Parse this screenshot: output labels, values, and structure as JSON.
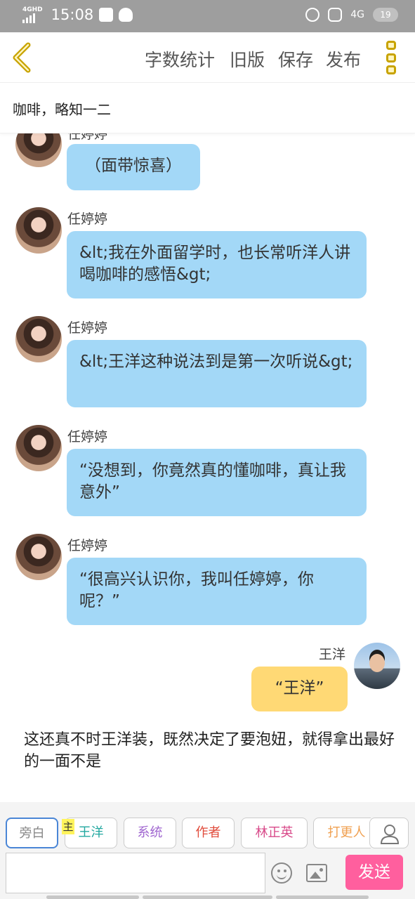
{
  "status_bar": {
    "network": "4GHD",
    "time": "15:08",
    "net2": "4G",
    "battery": "19"
  },
  "header": {
    "menu": [
      "字数统计",
      "旧版",
      "保存",
      "发布"
    ],
    "accent": "#c8a300"
  },
  "title": "咖啡，略知一二",
  "messages": [
    {
      "name": "任婷婷",
      "text": "（面带惊喜）",
      "side": "left"
    },
    {
      "name": "任婷婷",
      "text": "&lt;我在外面留学时，也长常听洋人讲喝咖啡的感悟&gt;",
      "side": "left"
    },
    {
      "name": "任婷婷",
      "text": "&lt;王洋这种说法到是第一次听说&gt;",
      "side": "left"
    },
    {
      "name": "任婷婷",
      "text": "“没想到，你竟然真的懂咖啡，真让我意外”",
      "side": "left"
    },
    {
      "name": "任婷婷",
      "text": "“很高兴认识你，我叫任婷婷，你呢？”",
      "side": "left"
    },
    {
      "name": "王洋",
      "text": "“王洋”",
      "side": "right"
    }
  ],
  "narration": "这还真不时王洋装，既然决定了要泡妞，就得拿出最好的一面不是",
  "roles": [
    {
      "label": "旁白",
      "color": "#888888"
    },
    {
      "label": "王洋",
      "color": "#22a8a0"
    },
    {
      "label": "系统",
      "color": "#a066d0"
    },
    {
      "label": "作者",
      "color": "#e04a3a"
    },
    {
      "label": "林正英",
      "color": "#d84a8a"
    },
    {
      "label": "打更人",
      "color": "#f0a050"
    }
  ],
  "role_tag": "主",
  "send_label": "发送",
  "colors": {
    "bubble_left": "#a3d8f7",
    "bubble_right": "#ffd975",
    "send": "#ff5f9e"
  }
}
